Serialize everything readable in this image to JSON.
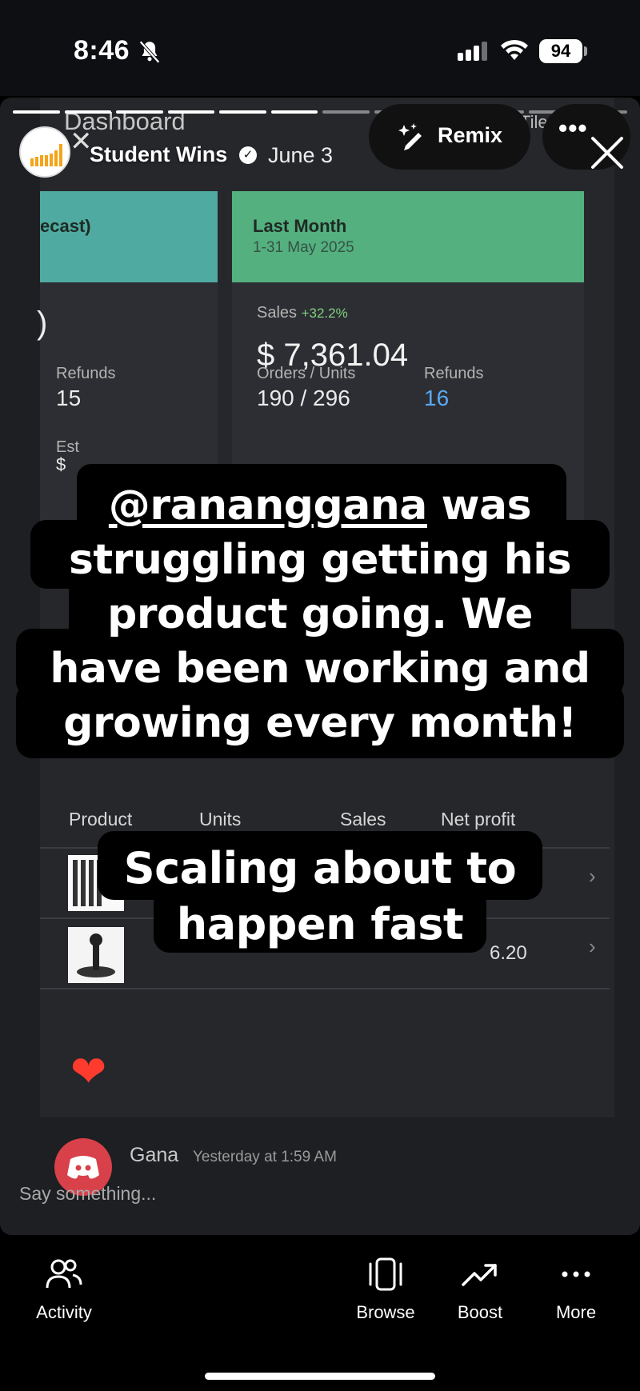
{
  "status_bar": {
    "time": "8:46",
    "battery": "94"
  },
  "header": {
    "account_name": "Student Wins",
    "date": "June 3",
    "remix_label": "Remix",
    "more_label": "•••"
  },
  "dashboard": {
    "title": "Dashboard",
    "view_label": "Tiles",
    "left_card": {
      "title_partial": "ecast)",
      "value_partial": ")",
      "refunds_label": "Refunds",
      "refunds_value": "15",
      "est_label_partial": "Est",
      "est_value_partial": "$"
    },
    "right_card": {
      "title": "Last Month",
      "date_range": "1-31 May 2025",
      "sales_label": "Sales",
      "sales_change": "+32.2%",
      "sales_value": "$ 7,361.04",
      "orders_label": "Orders / Units",
      "orders_value": "190 / 296",
      "refunds_label": "Refunds",
      "refunds_value": "16"
    },
    "table": {
      "columns": [
        "Product",
        "Units",
        "Sales",
        "Net profit"
      ],
      "rows": [
        {
          "net_profit_partial": ""
        },
        {
          "net_profit_partial": "6.20"
        }
      ]
    }
  },
  "captions": {
    "mention": "@rananggana",
    "line1_rest": " was",
    "line2": "struggling getting his",
    "line3": "product going. We",
    "line4": "have been working and",
    "line5": "growing every month!",
    "second_line1": "Scaling about to",
    "second_line2": "happen fast"
  },
  "comment": {
    "author": "Gana",
    "time": "Yesterday at 1:59 AM",
    "placeholder": "Say something..."
  },
  "bottom_nav": {
    "activity": "Activity",
    "browse": "Browse",
    "boost": "Boost",
    "more": "More"
  },
  "colors": {
    "teal_header": "#4faaa1",
    "green_header": "#54b07e",
    "refund_blue": "#5aa9f0",
    "positive_green": "#7fd27f",
    "discord_red": "#d8414a"
  }
}
